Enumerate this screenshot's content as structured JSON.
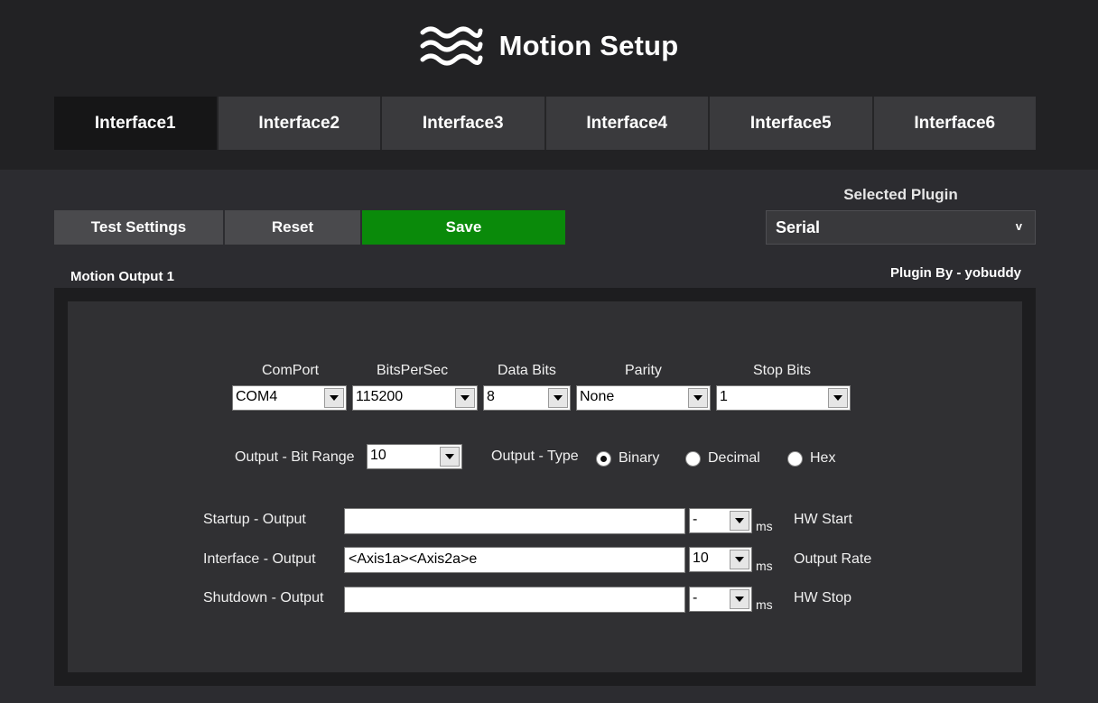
{
  "header": {
    "title": "Motion Setup",
    "logo_icon": "waves-icon"
  },
  "tabs": [
    {
      "label": "Interface1",
      "active": true
    },
    {
      "label": "Interface2",
      "active": false
    },
    {
      "label": "Interface3",
      "active": false
    },
    {
      "label": "Interface4",
      "active": false
    },
    {
      "label": "Interface5",
      "active": false
    },
    {
      "label": "Interface6",
      "active": false
    }
  ],
  "toolbar": {
    "test_label": "Test Settings",
    "reset_label": "Reset",
    "save_label": "Save"
  },
  "plugin": {
    "caption": "Selected Plugin",
    "selected": "Serial",
    "chevron": "v",
    "author": "Plugin By - yobuddy"
  },
  "section": {
    "title": "Motion Output 1"
  },
  "serial": {
    "comport": {
      "label": "ComPort",
      "value": "COM4"
    },
    "bits_per_sec": {
      "label": "BitsPerSec",
      "value": "115200"
    },
    "data_bits": {
      "label": "Data Bits",
      "value": "8"
    },
    "parity": {
      "label": "Parity",
      "value": "None"
    },
    "stop_bits": {
      "label": "Stop Bits",
      "value": "1"
    }
  },
  "output": {
    "bit_range_label": "Output - Bit Range",
    "bit_range_value": "10",
    "type_label": "Output - Type",
    "types": [
      {
        "label": "Binary",
        "checked": true
      },
      {
        "label": "Decimal",
        "checked": false
      },
      {
        "label": "Hex",
        "checked": false
      }
    ]
  },
  "rows": {
    "startup": {
      "label": "Startup - Output",
      "value": "",
      "ms_value": "-",
      "unit": "ms",
      "note": "HW Start"
    },
    "interface": {
      "label": "Interface - Output",
      "value": "<Axis1a><Axis2a>e",
      "ms_value": "10",
      "unit": "ms",
      "note": "Output Rate"
    },
    "shutdown": {
      "label": "Shutdown - Output",
      "value": "",
      "ms_value": "-",
      "unit": "ms",
      "note": "HW Stop"
    }
  },
  "colors": {
    "header_bg": "#222224",
    "body_bg": "#2c2c30",
    "tab_active": "#161617",
    "tab_inactive": "#3a3a3d",
    "save_green": "#0a8a0a"
  }
}
